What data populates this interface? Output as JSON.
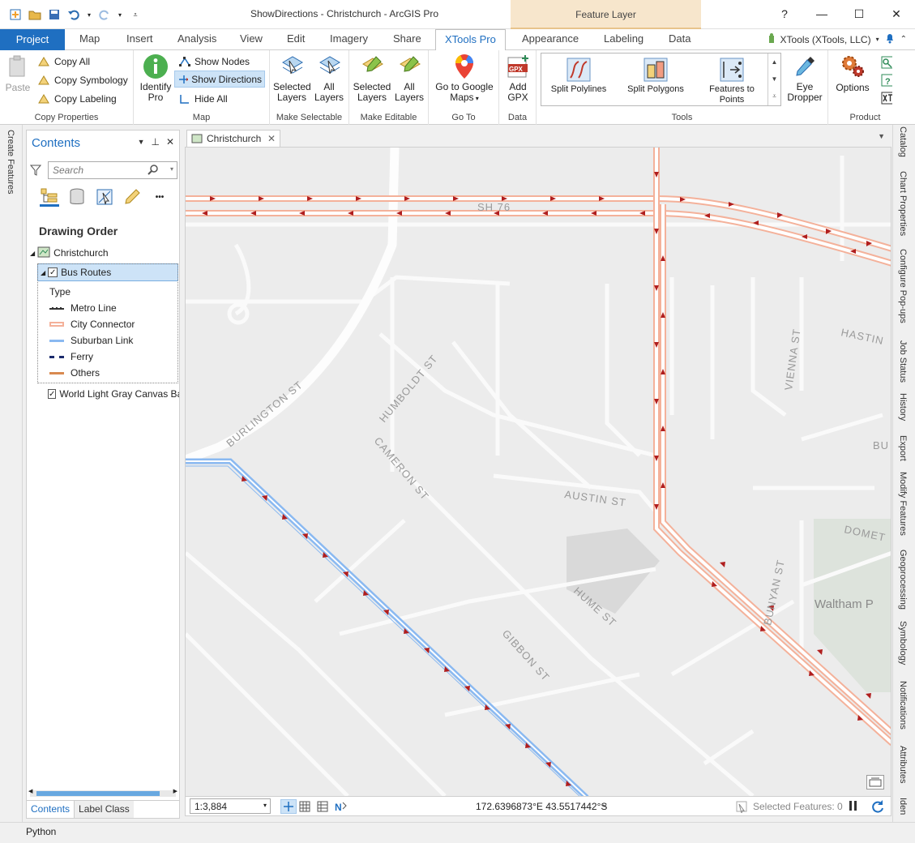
{
  "window": {
    "title": "ShowDirections - Christchurch - ArcGIS Pro",
    "context_tab": "Feature Layer",
    "help": "?",
    "minimize": "—",
    "maximize": "☐",
    "close": "✕"
  },
  "ribbon_tabs": {
    "project": "Project",
    "map": "Map",
    "insert": "Insert",
    "analysis": "Analysis",
    "view": "View",
    "edit": "Edit",
    "imagery": "Imagery",
    "share": "Share",
    "xtools": "XTools Pro",
    "appearance": "Appearance",
    "labeling": "Labeling",
    "data": "Data"
  },
  "user": {
    "name": "XTools (XTools, LLC)"
  },
  "ribbon": {
    "copy_properties": {
      "label": "Copy Properties",
      "paste": "Paste",
      "copy_all": "Copy All",
      "copy_symbology": "Copy Symbology",
      "copy_labeling": "Copy Labeling"
    },
    "map": {
      "label": "Map",
      "identify_1": "Identify",
      "identify_2": "Pro",
      "show_nodes": "Show Nodes",
      "show_directions": "Show Directions",
      "hide_all": "Hide All"
    },
    "make_selectable": {
      "label": "Make Selectable",
      "selected_1": "Selected",
      "selected_2": "Layers",
      "all_1": "All",
      "all_2": "Layers"
    },
    "make_editable": {
      "label": "Make Editable",
      "selected_1": "Selected",
      "selected_2": "Layers",
      "all_1": "All",
      "all_2": "Layers"
    },
    "go_to": {
      "label": "Go To",
      "google_1": "Go to Google",
      "google_2": "Maps"
    },
    "data": {
      "label": "Data",
      "gpx_badge": "GPX",
      "add_1": "Add",
      "add_2": "GPX"
    },
    "tools": {
      "label": "Tools",
      "split_polylines": "Split Polylines",
      "split_polygons": "Split Polygons",
      "features_1": "Features to",
      "features_2": "Points",
      "eye_1": "Eye",
      "eye_2": "Dropper"
    },
    "product": {
      "label": "Product",
      "options": "Options"
    }
  },
  "left_strip": {
    "create_features": "Create Features"
  },
  "contents": {
    "title": "Contents",
    "search_placeholder": "Search",
    "more": "•••",
    "drawing_order": "Drawing Order",
    "map_name": "Christchurch",
    "layer_bus": "Bus Routes",
    "type_heading": "Type",
    "legend": [
      {
        "label": "Metro Line",
        "color": "#333333"
      },
      {
        "label": "City Connector",
        "color": "#f4b19a"
      },
      {
        "label": "Suburban Link",
        "color": "#8ab9f1"
      },
      {
        "label": "Ferry",
        "color": "#1a2a6c"
      },
      {
        "label": "Others",
        "color": "#d98a50"
      }
    ],
    "layer_basemap": "World Light Gray Canvas Base",
    "tab_contents": "Contents",
    "tab_label_class": "Label Class"
  },
  "map": {
    "tab": "Christchurch",
    "scale": "1:3,884",
    "coordinates": "172.6396873°E 43.5517442°S",
    "selected_features": "Selected Features: 0",
    "streets": {
      "sh76": "SH 76",
      "burlington": "BURLINGTON ST",
      "humboldt": "HUMBOLDT ST",
      "cameron": "CAMERON ST",
      "austin": "AUSTIN ST",
      "hume": "HUME ST",
      "gibbon": "GIBBON ST",
      "vienna": "VIENNA ST",
      "bunyan": "BUNYAN ST",
      "hastin": "HASTIN",
      "domet": "DOMET",
      "bu": "BU",
      "waltham": "Waltham P"
    }
  },
  "right_strip": [
    "Catalog",
    "Chart Properties",
    "Configure Pop-ups",
    "Job Status",
    "History",
    "Export",
    "Modify Features",
    "Geoprocessing",
    "Symbology",
    "Notifications",
    "Attributes",
    "Iden"
  ],
  "bottom": {
    "python": "Python"
  }
}
